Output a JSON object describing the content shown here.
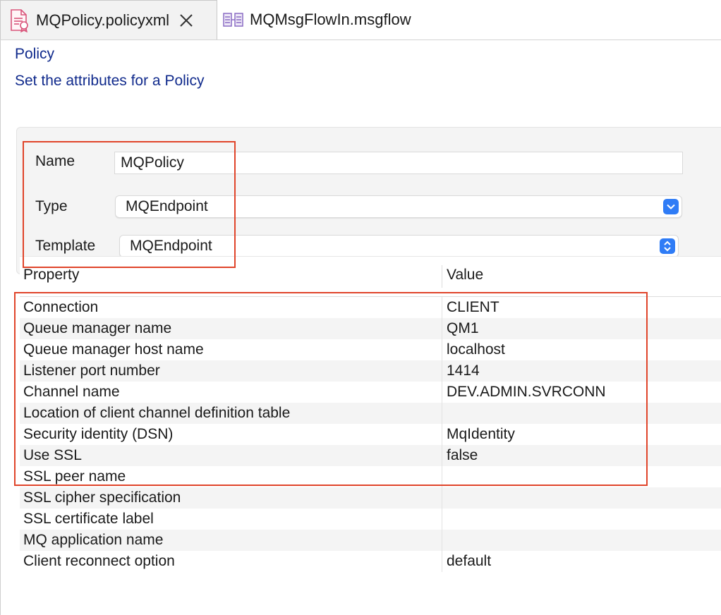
{
  "tabs": [
    {
      "label": "MQPolicy.policyxml",
      "icon": "policy-file-icon",
      "active": true
    },
    {
      "label": "MQMsgFlowIn.msgflow",
      "icon": "msgflow-file-icon",
      "active": false
    }
  ],
  "header": {
    "title": "Policy",
    "subtitle": "Set the attributes for a Policy"
  },
  "form": {
    "name_label": "Name",
    "name_value": "MQPolicy",
    "type_label": "Type",
    "type_value": "MQEndpoint",
    "template_label": "Template",
    "template_value": "MQEndpoint"
  },
  "table": {
    "columns": [
      "Property",
      "Value"
    ],
    "rows": [
      {
        "property": "Connection",
        "value": "CLIENT"
      },
      {
        "property": "Queue manager name",
        "value": "QM1"
      },
      {
        "property": "Queue manager host name",
        "value": "localhost"
      },
      {
        "property": "Listener port number",
        "value": "1414"
      },
      {
        "property": "Channel name",
        "value": "DEV.ADMIN.SVRCONN"
      },
      {
        "property": "Location of client channel definition table",
        "value": ""
      },
      {
        "property": "Security identity (DSN)",
        "value": "MqIdentity"
      },
      {
        "property": "Use SSL",
        "value": "false"
      },
      {
        "property": "SSL peer name",
        "value": ""
      },
      {
        "property": "SSL cipher specification",
        "value": ""
      },
      {
        "property": "SSL certificate label",
        "value": ""
      },
      {
        "property": "MQ application name",
        "value": ""
      },
      {
        "property": "Client reconnect option",
        "value": "default"
      }
    ]
  },
  "colors": {
    "header_text": "#102a8c",
    "highlight": "#e0442a",
    "select_arrow": "#2f7cf6",
    "row_stripe": "#f4f4f4"
  }
}
